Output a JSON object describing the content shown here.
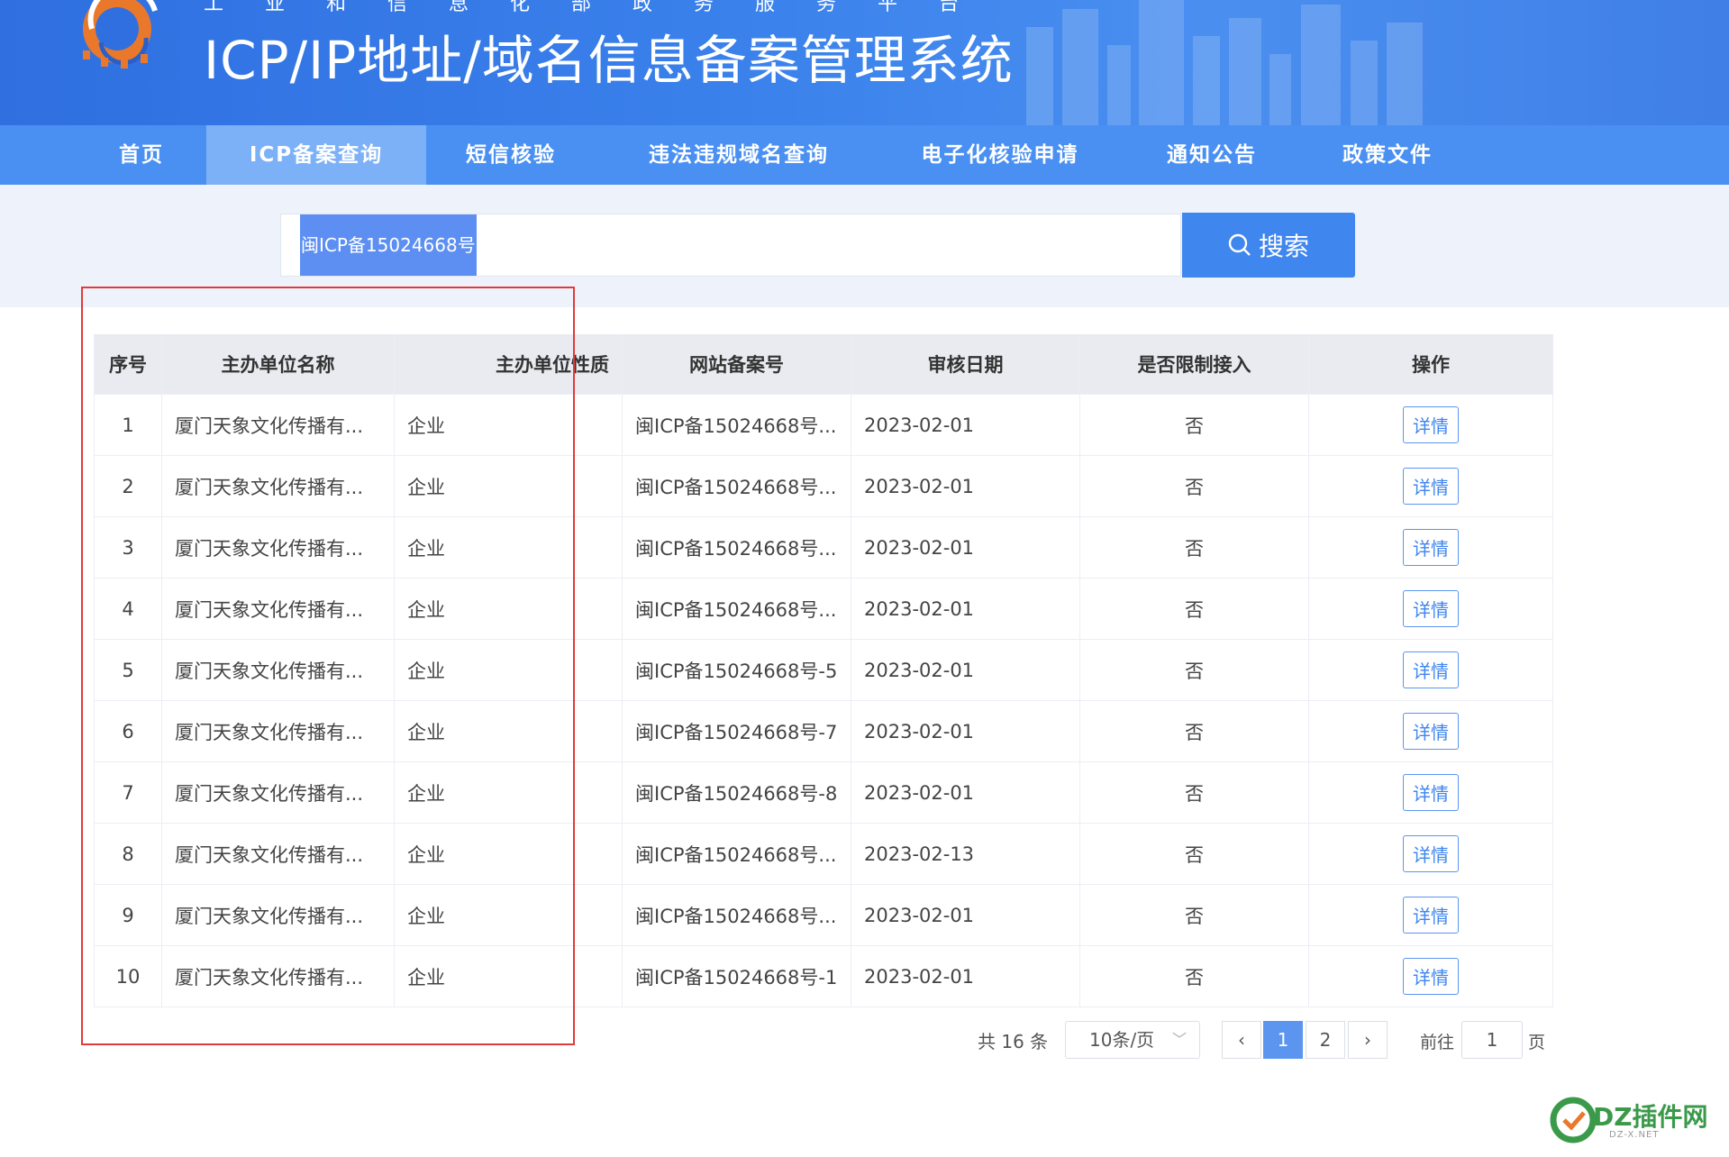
{
  "header": {
    "subtitle": "工业和信息化部政务服务平台",
    "title": "ICP/IP地址/域名信息备案管理系统"
  },
  "nav": {
    "items": [
      {
        "label": "首页"
      },
      {
        "label": "ICP备案查询"
      },
      {
        "label": "短信核验"
      },
      {
        "label": "违法违规域名查询"
      },
      {
        "label": "电子化核验申请"
      },
      {
        "label": "通知公告"
      },
      {
        "label": "政策文件"
      }
    ],
    "active": "ICP备案查询"
  },
  "search": {
    "value": "闽ICP备15024668号",
    "button_label": "搜索",
    "button_icon": "search-icon"
  },
  "table": {
    "headers": [
      "序号",
      "主办单位名称",
      "主办单位性质",
      "网站备案号",
      "审核日期",
      "是否限制接入",
      "操作"
    ],
    "rows": [
      [
        "1",
        "厦门天象文化传播有...",
        "企业",
        "闽ICP备15024668号...",
        "2023-02-01",
        "否",
        "详情"
      ],
      [
        "2",
        "厦门天象文化传播有...",
        "企业",
        "闽ICP备15024668号...",
        "2023-02-01",
        "否",
        "详情"
      ],
      [
        "3",
        "厦门天象文化传播有...",
        "企业",
        "闽ICP备15024668号...",
        "2023-02-01",
        "否",
        "详情"
      ],
      [
        "4",
        "厦门天象文化传播有...",
        "企业",
        "闽ICP备15024668号...",
        "2023-02-01",
        "否",
        "详情"
      ],
      [
        "5",
        "厦门天象文化传播有...",
        "企业",
        "闽ICP备15024668号-5",
        "2023-02-01",
        "否",
        "详情"
      ],
      [
        "6",
        "厦门天象文化传播有...",
        "企业",
        "闽ICP备15024668号-7",
        "2023-02-01",
        "否",
        "详情"
      ],
      [
        "7",
        "厦门天象文化传播有...",
        "企业",
        "闽ICP备15024668号-8",
        "2023-02-01",
        "否",
        "详情"
      ],
      [
        "8",
        "厦门天象文化传播有...",
        "企业",
        "闽ICP备15024668号...",
        "2023-02-13",
        "否",
        "详情"
      ],
      [
        "9",
        "厦门天象文化传播有...",
        "企业",
        "闽ICP备15024668号...",
        "2023-02-01",
        "否",
        "详情"
      ],
      [
        "10",
        "厦门天象文化传播有...",
        "企业",
        "闽ICP备15024668号-1",
        "2023-02-01",
        "否",
        "详情"
      ]
    ]
  },
  "pagination": {
    "total": "共 16 条",
    "page_size": "10条/页",
    "prev": "‹",
    "pages": [
      "1",
      "2"
    ],
    "current": "1",
    "next": "›",
    "goto_label": "前往",
    "goto_value": "1",
    "page_suffix": "页"
  },
  "watermark": {
    "text": "DZ插件网",
    "sub": "DZ-X.NET"
  },
  "colors": {
    "header_blue": "#3b82ec",
    "nav_blue": "#4a90f2",
    "nav_active": "#7db1f7",
    "button_blue": "#3f86ef",
    "highlight_red": "#e23a3a",
    "watermark_green": "#3a9a4a"
  }
}
